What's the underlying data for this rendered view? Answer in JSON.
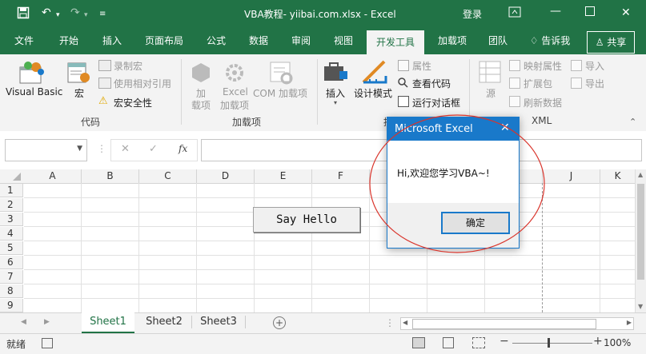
{
  "titlebar": {
    "title": "VBA教程- yiibai.com.xlsx  -  Excel",
    "login": "登录",
    "bg": "#217346"
  },
  "tabs": [
    {
      "label": "文件"
    },
    {
      "label": "开始"
    },
    {
      "label": "插入"
    },
    {
      "label": "页面布局"
    },
    {
      "label": "公式"
    },
    {
      "label": "数据"
    },
    {
      "label": "审阅"
    },
    {
      "label": "视图"
    },
    {
      "label": "开发工具",
      "active": true
    },
    {
      "label": "加载项"
    },
    {
      "label": "团队"
    }
  ],
  "tell_me": "告诉我",
  "share": "共享",
  "ribbon": {
    "code": {
      "visual_basic": "Visual Basic",
      "macros": "宏",
      "record_macro": "录制宏",
      "relative_ref": "使用相对引用",
      "macro_security": "宏安全性",
      "group": "代码"
    },
    "addins": {
      "addin_1": "加",
      "addin_2": "载项",
      "excel_addins_1": "Excel",
      "excel_addins_2": "加载项",
      "com_addins_1": "COM 加载项",
      "group": "加载项"
    },
    "controls": {
      "insert": "插入",
      "design_mode": "设计模式",
      "properties": "属性",
      "view_code": "查看代码",
      "run_dialog": "运行对话框",
      "group_partial": "控"
    },
    "xml": {
      "source": "源",
      "map_props": "映射属性",
      "expansion": "扩展包",
      "refresh": "刷新数据",
      "import": "导入",
      "export": "导出",
      "group": "XML"
    }
  },
  "formula_bar": {
    "name_box": "",
    "cancel_icon": "✕",
    "enter_icon": "✓",
    "fx": "fx",
    "formula": ""
  },
  "grid": {
    "columns": [
      "A",
      "B",
      "C",
      "D",
      "E",
      "F",
      "G",
      "H",
      "I",
      "J",
      "K"
    ],
    "rows": [
      "1",
      "2",
      "3",
      "4",
      "5",
      "6",
      "7",
      "8",
      "9"
    ]
  },
  "button": {
    "label": "Say Hello"
  },
  "dialog": {
    "title": "Microsoft Excel",
    "message": "Hi,欢迎您学习VBA~!",
    "ok": "确定",
    "close": "✕"
  },
  "sheets": [
    {
      "label": "Sheet1",
      "active": true
    },
    {
      "label": "Sheet2"
    },
    {
      "label": "Sheet3"
    }
  ],
  "status": {
    "ready": "就绪",
    "zoom": "100%"
  },
  "colors": {
    "accent": "#217346",
    "dialog": "#1979ca",
    "annotation": "#d9342b"
  }
}
